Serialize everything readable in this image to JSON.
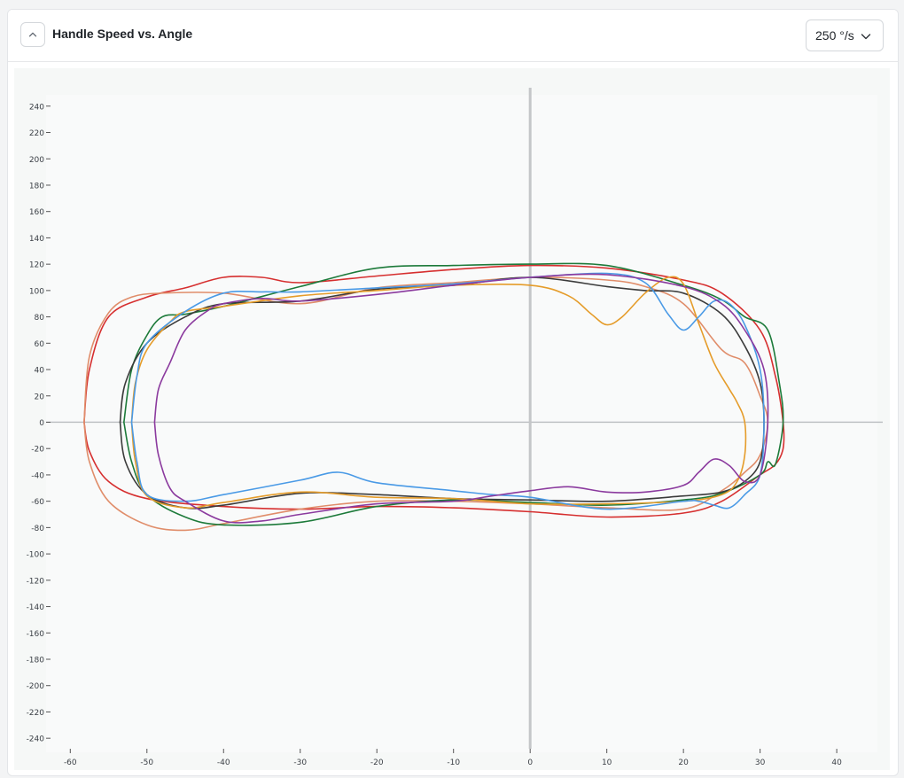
{
  "header": {
    "title": "Handle Speed vs. Angle",
    "speed_option": "250 °/s"
  },
  "chart_data": {
    "type": "line",
    "title": "Handle Speed vs. Angle",
    "xlabel": "",
    "ylabel": "",
    "xlim": [
      -62,
      46
    ],
    "ylim": [
      -252,
      254
    ],
    "x_ticks": [
      -60,
      -50,
      -40,
      -30,
      -20,
      -10,
      0,
      10,
      20,
      30,
      40
    ],
    "y_ticks": [
      240,
      220,
      200,
      180,
      160,
      140,
      120,
      100,
      80,
      60,
      40,
      20,
      0,
      -20,
      -40,
      -60,
      -80,
      -100,
      -120,
      -140,
      -160,
      -180,
      -200,
      -220,
      -240
    ],
    "grid": false,
    "zero_lines": true,
    "series": [
      {
        "color": "#d62f2f",
        "x": [
          -58.2,
          -57.5,
          -55,
          -50,
          -45,
          -40,
          -35,
          -30,
          -20,
          -10,
          0,
          10,
          20,
          25,
          30,
          32,
          33,
          33,
          32,
          30,
          25,
          20,
          10,
          0,
          -10,
          -20,
          -30,
          -40,
          -50,
          -55,
          -57.5,
          -58.2
        ],
        "y": [
          0,
          40,
          80,
          95,
          102,
          110,
          110,
          106,
          111,
          116,
          119,
          117,
          108,
          98,
          70,
          35,
          0,
          -20,
          -32,
          -40,
          -60,
          -69,
          -72,
          -68,
          -65,
          -64,
          -66,
          -64,
          -58,
          -45,
          -22,
          0
        ]
      },
      {
        "color": "#e08d6a",
        "x": [
          -58.2,
          -57.5,
          -55,
          -52,
          -48,
          -40,
          -30,
          -20,
          -10,
          0,
          10,
          15,
          20,
          25,
          28,
          30,
          31,
          30,
          28,
          25,
          20,
          10,
          0,
          -10,
          -20,
          -30,
          -40,
          -45,
          -50,
          -55,
          -57.5,
          -58.2
        ],
        "y": [
          0,
          50,
          83,
          95,
          98,
          98,
          90,
          102,
          106,
          110,
          108,
          103,
          90,
          55,
          45,
          20,
          0,
          -25,
          -38,
          -52,
          -66,
          -65,
          -62,
          -60,
          -60,
          -66,
          -77,
          -82,
          -78,
          -60,
          -30,
          0
        ]
      },
      {
        "color": "#1d7a3a",
        "x": [
          -53,
          -52,
          -50,
          -48,
          -45,
          -40,
          -30,
          -20,
          -10,
          0,
          10,
          20,
          25,
          28,
          31,
          32.5,
          33,
          32,
          31,
          30,
          25,
          20,
          10,
          0,
          -10,
          -20,
          -30,
          -40,
          -45,
          -50,
          -52,
          -53
        ],
        "y": [
          0,
          40,
          66,
          80,
          82,
          88,
          103,
          117,
          119,
          120,
          119,
          104,
          93,
          80,
          70,
          30,
          0,
          -32,
          -30,
          -40,
          -54,
          -59,
          -63,
          -61,
          -59,
          -64,
          -76,
          -78,
          -72,
          -55,
          -30,
          0
        ]
      },
      {
        "color": "#3b3b3b",
        "x": [
          -53.5,
          -52.8,
          -50,
          -45,
          -40,
          -30,
          -20,
          -10,
          0,
          10,
          15,
          20,
          25,
          28,
          30,
          30.5,
          30,
          28,
          25,
          20,
          10,
          0,
          -10,
          -20,
          -30,
          -40,
          -45,
          -50,
          -52.8,
          -53.5
        ],
        "y": [
          0,
          30,
          60,
          80,
          90,
          92,
          101,
          104,
          110,
          103,
          100,
          98,
          82,
          58,
          30,
          0,
          -30,
          -45,
          -53,
          -56,
          -60,
          -59,
          -58,
          -55,
          -54,
          -63,
          -65,
          -55,
          -30,
          0
        ]
      },
      {
        "color": "#e59c2a",
        "x": [
          -52,
          -51.5,
          -50,
          -47,
          -45,
          -40,
          -30,
          -20,
          -10,
          0,
          5,
          8,
          10,
          12,
          15,
          18,
          20,
          22,
          24,
          26,
          27,
          28,
          28,
          27,
          25,
          20,
          10,
          0,
          -10,
          -20,
          -30,
          -40,
          -45,
          -50,
          -51.5,
          -52
        ],
        "y": [
          0,
          30,
          55,
          76,
          84,
          88,
          96,
          100,
          104,
          104,
          96,
          82,
          74,
          80,
          98,
          110,
          105,
          75,
          45,
          25,
          15,
          0,
          -25,
          -45,
          -55,
          -60,
          -62,
          -62,
          -58,
          -57,
          -53,
          -61,
          -65,
          -56,
          -30,
          0
        ]
      },
      {
        "color": "#4a9ae6",
        "x": [
          -52,
          -51.3,
          -50,
          -45,
          -40,
          -35,
          -30,
          -20,
          -10,
          0,
          10,
          15,
          18,
          20,
          22,
          24,
          26,
          28,
          30,
          30.5,
          30,
          28,
          26,
          24,
          22,
          20,
          10,
          0,
          -5,
          -10,
          -20,
          -25,
          -30,
          -40,
          -45,
          -50,
          -51.3,
          -52
        ],
        "y": [
          0,
          35,
          60,
          84,
          98,
          99,
          99,
          102,
          105,
          110,
          113,
          106,
          82,
          70,
          80,
          92,
          90,
          74,
          40,
          0,
          -40,
          -55,
          -65,
          -63,
          -60,
          -60,
          -66,
          -57,
          -55,
          -52,
          -46,
          -38,
          -44,
          -55,
          -60,
          -55,
          -30,
          0
        ]
      },
      {
        "color": "#8b3a9e",
        "x": [
          -49,
          -48.5,
          -47,
          -45,
          -42,
          -40,
          -35,
          -30,
          -20,
          -10,
          0,
          10,
          20,
          25,
          28,
          30.5,
          31,
          30,
          28,
          26,
          24,
          22,
          20,
          15,
          10,
          5,
          0,
          -5,
          -10,
          -20,
          -30,
          -35,
          -40,
          -45,
          -47,
          -48.5,
          -49
        ],
        "y": [
          0,
          25,
          45,
          70,
          85,
          90,
          94,
          92,
          97,
          104,
          110,
          112,
          103,
          90,
          70,
          40,
          0,
          -40,
          -45,
          -33,
          -28,
          -38,
          -48,
          -53,
          -53,
          -49,
          -52,
          -56,
          -60,
          -62,
          -70,
          -75,
          -75,
          -60,
          -50,
          -25,
          0
        ]
      }
    ]
  }
}
